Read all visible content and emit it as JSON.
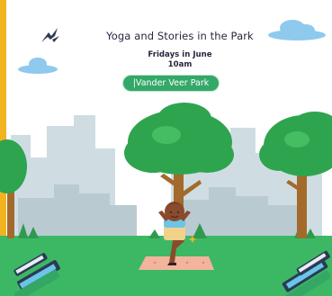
{
  "event": {
    "title": "Yoga and Stories in the Park",
    "schedule_day": "Fridays in June",
    "schedule_time": "10am",
    "location": "|Vander Veer Park"
  },
  "colors": {
    "accent_bar": "#f2b320",
    "grass": "#3cb865",
    "location_pill": "#34a868",
    "sky_clouds": "#8ec9ee",
    "skyline": "#cfdde2"
  },
  "icons": [
    "birds-icon",
    "cloud-icon",
    "tree-icon",
    "book-stack-icon",
    "yoga-mat-icon"
  ]
}
